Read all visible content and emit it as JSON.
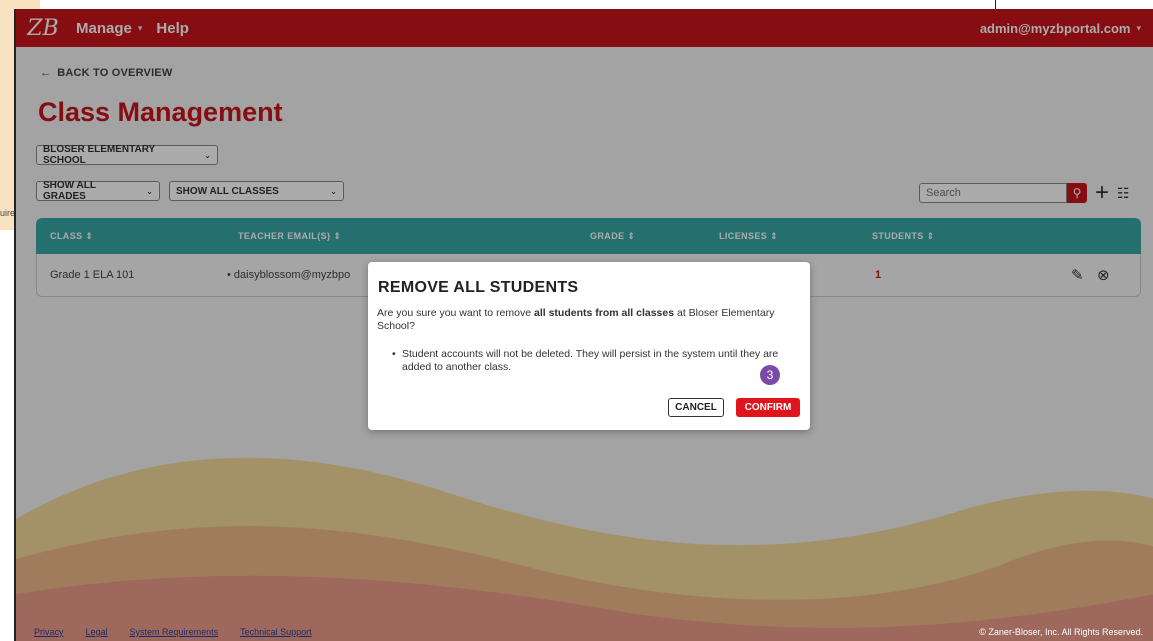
{
  "outside": {
    "stub_text": "uiren"
  },
  "topbar": {
    "logo": "ZB",
    "nav": [
      {
        "label": "Manage"
      },
      {
        "label": "Help"
      }
    ],
    "user": "admin@myzbportal.com"
  },
  "back_link": "BACK TO OVERVIEW",
  "page_title": "Class Management",
  "filters": {
    "school": "BLOSER ELEMENTARY SCHOOL",
    "grades": "SHOW ALL GRADES",
    "classes": "SHOW ALL CLASSES"
  },
  "search": {
    "placeholder": "Search"
  },
  "table": {
    "headers": [
      "CLASS",
      "TEACHER EMAIL(S)",
      "GRADE",
      "LICENSES",
      "STUDENTS"
    ],
    "rows": [
      {
        "class": "Grade 1 ELA 101",
        "teacher": "daisyblossom@myzbpo",
        "students": "1"
      }
    ]
  },
  "modal": {
    "title": "REMOVE ALL STUDENTS",
    "body_prefix": "Are you sure you want to remove ",
    "body_bold": "all students from all classes",
    "body_suffix": " at Bloser Elementary School?",
    "bullet": "Student accounts will not be deleted. They will persist in the system until they are added to another class.",
    "step": "3",
    "cancel": "CANCEL",
    "confirm": "CONFIRM"
  },
  "footer": {
    "links": [
      "Privacy",
      "Legal",
      "System Requirements",
      "Technical Support"
    ],
    "copyright": "© Zaner-Bloser, Inc. All Rights Reserved."
  },
  "colors": {
    "brand_red": "#c8141b",
    "table_header": "#3aa6a6",
    "step_badge": "#7a4aa8"
  }
}
